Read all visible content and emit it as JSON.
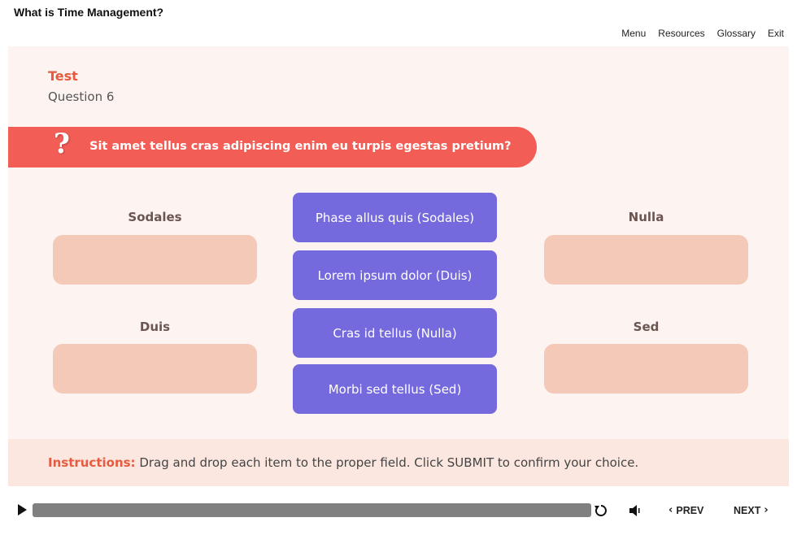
{
  "header": {
    "course_title": "What is Time Management?",
    "nav": [
      "Menu",
      "Resources",
      "Glossary",
      "Exit"
    ]
  },
  "question": {
    "section": "Test",
    "number_label": "Question 6",
    "icon": "question-mark-icon",
    "text": "Sit amet tellus cras adipiscing enim eu turpis egestas pretium?"
  },
  "drop_zones": [
    {
      "label": "Sodales"
    },
    {
      "label": "Nulla"
    },
    {
      "label": "Duis"
    },
    {
      "label": "Sed"
    }
  ],
  "drag_items": [
    "Phase allus quis (Sodales)",
    "Lorem ipsum dolor (Duis)",
    "Cras id tellus (Nulla)",
    "Morbi sed tellus (Sed)"
  ],
  "instructions": {
    "label": "Instructions:",
    "text": " Drag and drop each item to the proper field. Click SUBMIT to confirm your choice."
  },
  "player": {
    "prev_label": "PREV",
    "next_label": "NEXT",
    "icons": [
      "play-icon",
      "replay-icon",
      "volume-icon"
    ]
  },
  "colors": {
    "accent": "#e65a3f",
    "question_bar": "#f25d55",
    "drag_item": "#7469dd",
    "drop_zone": "#f5c9b8",
    "stage_bg": "#fdf4f1",
    "instructions_bg": "#fbe7df"
  }
}
